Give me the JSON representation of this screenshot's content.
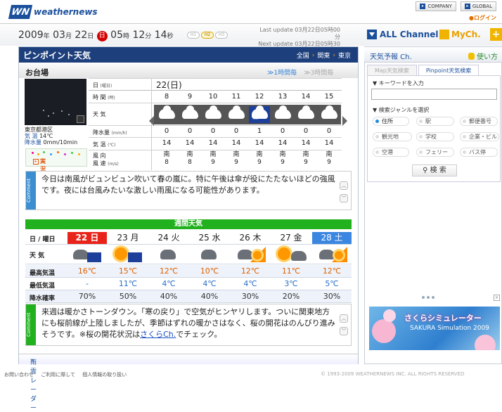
{
  "header": {
    "logo_mark": "WN",
    "logo_text": "weathernews",
    "company": "COMPANY",
    "global": "GLOBAL",
    "login": "ログイン"
  },
  "datebar": {
    "year": "2009",
    "month": "03",
    "day": "22",
    "dow": "日",
    "hour": "05",
    "minute": "12",
    "second": "14",
    "y_u": "年",
    "m_u": "月",
    "d_u": "日",
    "h_u": "時",
    "mi_u": "分",
    "s_u": "秒",
    "hbtn1": "H1",
    "hbtn2": "H2",
    "hbtn3": "H3",
    "last_update": "Last update  03月22日05時00分",
    "next_update": "Next update  03月22日05時30分",
    "all_channel": "ALL Channel",
    "mych": "MyCh."
  },
  "pinpoint": {
    "title": "ピンポイント天気",
    "crumbs": [
      "全国",
      "関東",
      "東京"
    ],
    "location": "お台場",
    "hour1": "≫1時間毎",
    "hour3": "≫3時間毎",
    "day_label": "日",
    "day_small": "(曜日)",
    "day_value": "22(日)",
    "time_label": "時 間",
    "time_small": "(時)",
    "hours": [
      "8",
      "9",
      "10",
      "11",
      "12",
      "13",
      "14",
      "15"
    ],
    "weather_label": "天 気",
    "precip_label": "降水量",
    "precip_small": "(mm/h)",
    "precip": [
      "0",
      "0",
      "0",
      "0",
      "1",
      "0",
      "0",
      "0"
    ],
    "temp_label": "気 温",
    "temp_small": "(℃)",
    "temp": [
      "14",
      "14",
      "14",
      "14",
      "14",
      "14",
      "14",
      "14"
    ],
    "wind_label": "風 向",
    "wind_label2": "風 速",
    "wind_small": "(m/s)",
    "wind_dir": [
      "南",
      "南",
      "南",
      "南",
      "南",
      "南",
      "南",
      "南"
    ],
    "wind_speed": [
      "8",
      "8",
      "9",
      "9",
      "9",
      "9",
      "9",
      "9"
    ],
    "cam_area": "東京都港区",
    "cam_temp_label": "気 温",
    "cam_temp": "14℃",
    "cam_precip_label": "降水量",
    "cam_precip": "0mm/10min",
    "cam_live": "実況値",
    "comment_tag": "Comment",
    "comment": "今日は南風がビュンビュン吹いて春の嵐に。特に午後は傘が役にたたないほどの強風です。夜には台風みたいな激しい雨風になる可能性があります。"
  },
  "weekly": {
    "title": "週間天気",
    "date_label": "日 / 曜日",
    "dates": [
      "22 日",
      "23 月",
      "24 火",
      "25 水",
      "26 木",
      "27 金",
      "28 土"
    ],
    "weather_label": "天 気",
    "max_label": "最高気温",
    "max": [
      "16℃",
      "15℃",
      "12℃",
      "10℃",
      "12℃",
      "11℃",
      "12℃"
    ],
    "min_label": "最低気温",
    "min": [
      "-",
      "11℃",
      "4℃",
      "4℃",
      "4℃",
      "3℃",
      "5℃"
    ],
    "pop_label": "降水確率",
    "pop": [
      "70%",
      "50%",
      "40%",
      "40%",
      "30%",
      "20%",
      "30%"
    ],
    "comment_pre": "来週は暖かさトーンダウン。「寒の戻り」で空気がヒンヤリします。ついに関東地方にも桜前線が上陸しましたが、季節はずれの暖かさはなく、桜の開花はのんびり進みそうです。※桜の開花状況は",
    "comment_link": "さくらCh.",
    "comment_post": "でチェック。"
  },
  "radar": "雨雲レーダー",
  "footer": {
    "links": [
      "お問い合わせ",
      "ご利用に際して",
      "個人情報の取り扱い"
    ],
    "copyright": "© 1993-2009 WEATHERNEWS INC. ALL RIGHTS RESERVED"
  },
  "right": {
    "title": "天気予報 Ch.",
    "howto": "使い方",
    "tab1": "Map天気検索",
    "tab2": "Pinpoint天気検索",
    "kw_label": "▼ キーワードを入力",
    "genre_label": "▼ 検索ジャンルを選択",
    "options": [
      "住所",
      "駅",
      "郵便番号",
      "観光地",
      "学校",
      "企業・ビル",
      "空港",
      "フェリー",
      "バス停"
    ],
    "search": "検 索",
    "banner_title": "さくらシミュレーター",
    "banner_sub": "SAKURA Simulation 2009"
  },
  "colors": {
    "navy": "#1d3f7c",
    "green": "#22b11e",
    "sunday": "#e8231a",
    "saturday": "#3b86e0",
    "comment": "#3b8fd0"
  }
}
